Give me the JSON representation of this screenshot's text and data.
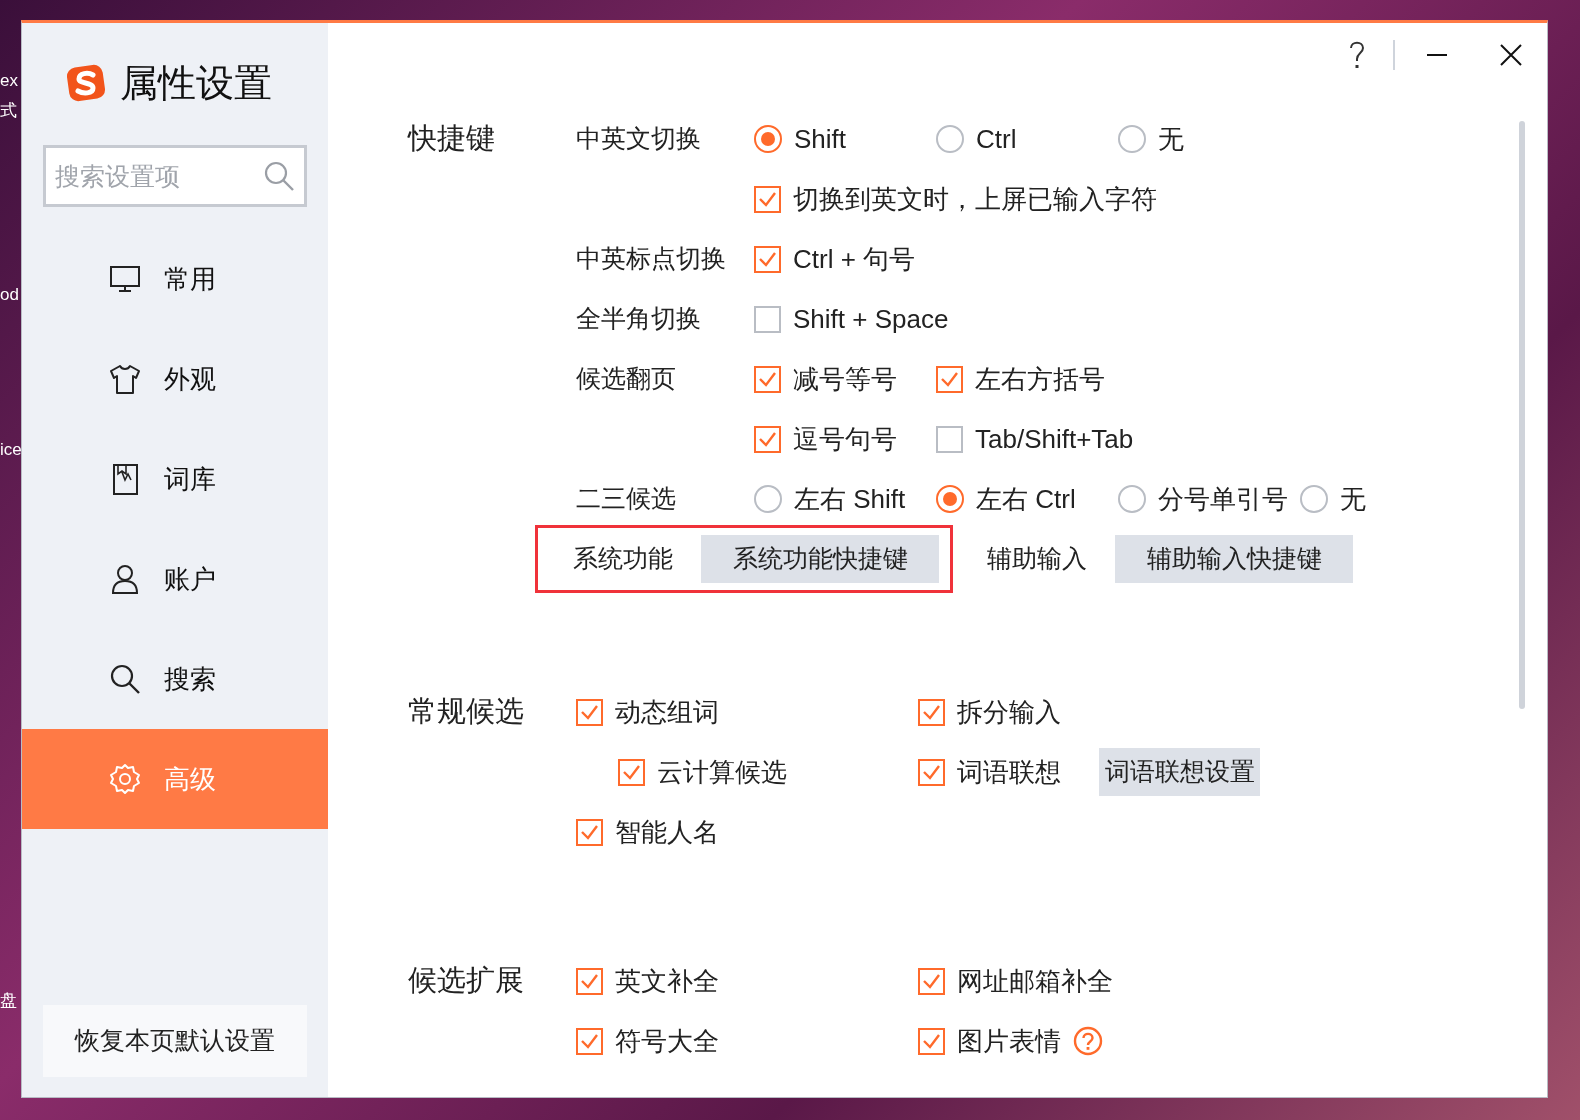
{
  "desktop": {
    "labels": [
      "ex",
      "式",
      "od",
      "ice",
      "盘"
    ]
  },
  "window": {
    "title": "属性设置"
  },
  "sidebar": {
    "search": {
      "placeholder": "搜索设置项"
    },
    "items": [
      {
        "label": "常用",
        "selected": false
      },
      {
        "label": "外观",
        "selected": false
      },
      {
        "label": "词库",
        "selected": false
      },
      {
        "label": "账户",
        "selected": false
      },
      {
        "label": "搜索",
        "selected": false
      },
      {
        "label": "高级",
        "selected": true
      }
    ],
    "restore_button": "恢复本页默认设置"
  },
  "sections": [
    {
      "title": "快捷键",
      "rows": [
        {
          "label": "中英文切换",
          "items": [
            {
              "kind": "radio",
              "text": "Shift",
              "selected": true
            },
            {
              "kind": "radio",
              "text": "Ctrl",
              "selected": false
            },
            {
              "kind": "radio",
              "text": "无",
              "selected": false
            }
          ]
        },
        {
          "items": [
            {
              "kind": "checkbox",
              "text": "切换到英文时，上屏已输入字符",
              "checked": true
            }
          ]
        },
        {
          "label": "中英标点切换",
          "items": [
            {
              "kind": "checkbox",
              "text": "Ctrl + 句号",
              "checked": true
            }
          ]
        },
        {
          "label": "全半角切换",
          "items": [
            {
              "kind": "checkbox",
              "text": "Shift + Space",
              "checked": false
            }
          ]
        },
        {
          "label": "候选翻页",
          "items": [
            {
              "kind": "checkbox",
              "text": "减号等号",
              "checked": true
            },
            {
              "kind": "checkbox",
              "text": "左右方括号",
              "checked": true
            }
          ]
        },
        {
          "items": [
            {
              "kind": "checkbox",
              "text": "逗号句号",
              "checked": true
            },
            {
              "kind": "checkbox",
              "text": "Tab/Shift+Tab",
              "checked": false
            }
          ]
        },
        {
          "label": "二三候选",
          "items": [
            {
              "kind": "radio",
              "text": "左右 Shift",
              "selected": false
            },
            {
              "kind": "radio",
              "text": "左右 Ctrl",
              "selected": true
            },
            {
              "kind": "radio",
              "text": "分号单引号",
              "selected": false
            },
            {
              "kind": "radio",
              "text": "无",
              "selected": false
            }
          ]
        }
      ],
      "groups": [
        {
          "label": "系统功能",
          "button": "系统功能快捷键",
          "highlighted": true
        },
        {
          "label": "辅助输入",
          "button": "辅助输入快捷键",
          "highlighted": false
        }
      ]
    },
    {
      "title": "常规候选",
      "columns": [
        [
          {
            "kind": "checkbox",
            "text": "动态组词",
            "checked": true,
            "children": [
              {
                "kind": "checkbox",
                "text": "云计算候选",
                "checked": true
              }
            ]
          },
          {
            "kind": "checkbox",
            "text": "智能人名",
            "checked": true
          }
        ],
        [
          {
            "kind": "checkbox",
            "text": "拆分输入",
            "checked": true
          },
          {
            "kind": "checkbox",
            "text": "词语联想",
            "checked": true,
            "button": "词语联想设置"
          }
        ]
      ]
    },
    {
      "title": "候选扩展",
      "columns": [
        [
          {
            "kind": "checkbox",
            "text": "英文补全",
            "checked": true
          },
          {
            "kind": "checkbox",
            "text": "符号大全",
            "checked": true
          }
        ],
        [
          {
            "kind": "checkbox",
            "text": "网址邮箱补全",
            "checked": true
          },
          {
            "kind": "checkbox",
            "text": "图片表情",
            "checked": true,
            "help": true
          }
        ]
      ]
    }
  ]
}
